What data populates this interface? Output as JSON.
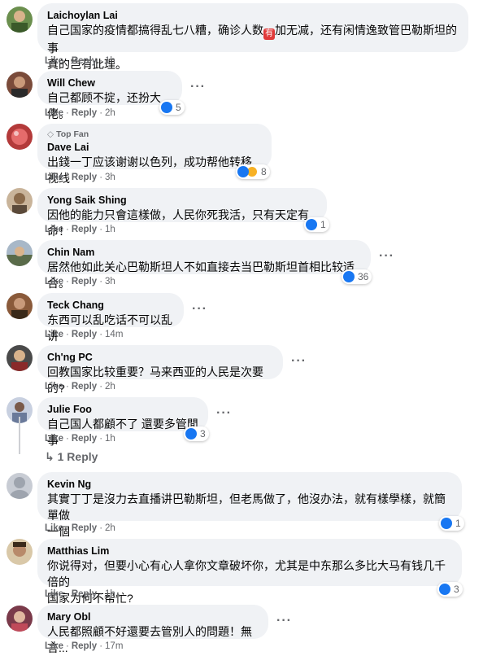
{
  "action_labels": {
    "like": "Like",
    "reply": "Reply",
    "dot": "·"
  },
  "comments": [
    {
      "author": "Laichoylan Lai",
      "text_a": "自己国家的疫情都搞得乱七八糟，确诊人数",
      "emoji": "有",
      "text_b": "加无减，还有闲情逸致管巴勒斯坦的事",
      "text_c": "真的岂有此理。",
      "time": "1h"
    },
    {
      "author": "Will Chew",
      "text": "自己都顾不掟，还扮大佬。",
      "time": "2h",
      "reactions": "5"
    },
    {
      "badge": "Top Fan",
      "author": "Dave Lai",
      "text": "出錢一丁应该谢谢以色列，成功帮他转移视线",
      "time": "3h",
      "reactions": "8"
    },
    {
      "author": "Yong Saik Shing",
      "text": "因他的能力只會這樣做，人民你死我活，只有天定有命！",
      "time": "1h",
      "reactions": "1"
    },
    {
      "author": "Chin Nam",
      "text": "居然他如此关心巴勒斯坦人不如直接去当巴勒斯坦首相比较适合。",
      "time": "3h",
      "reactions": "36"
    },
    {
      "author": "Teck Chang",
      "text": "东西可以乱吃话不可以乱讲",
      "time": "14m"
    },
    {
      "author": "Ch'ng PC",
      "text": "回教国家比较重要？马来西亚的人民是次要的?",
      "time": "2h"
    },
    {
      "author": "Julie Foo",
      "text": "自己国人都顧不了 還要多管閒事",
      "time": "1h",
      "reactions": "3"
    },
    {
      "author": "Kevin Ng",
      "text_a": "其實丁丁是沒力去直播讲巴勒斯坦，但老馬做了，他沒办法，就有樣學樣，就簡單做",
      "text_b": "一個",
      "time": "2h",
      "reactions": "1"
    },
    {
      "author": "Matthias Lim",
      "text_a": "你说得对，但要小心有心人拿你文章破坏你，尤其是中东那么多比大马有钱几千倍的",
      "text_b": "国家为何不帮忙?",
      "time": "1h",
      "reactions": "3"
    },
    {
      "author": "Mary Obl",
      "text": "人民都照顧不好還要去管別人的問題！無言...",
      "time": "17m"
    }
  ],
  "replies_link": "↳ 1 Reply",
  "more_label": "···",
  "colors": {
    "bubble": "#f0f2f5",
    "meta": "#65676b",
    "like": "#1877f2",
    "haha": "#f7b125"
  },
  "icons": {
    "like": "like-icon",
    "haha": "haha-icon",
    "top_fan": "diamond-icon"
  }
}
